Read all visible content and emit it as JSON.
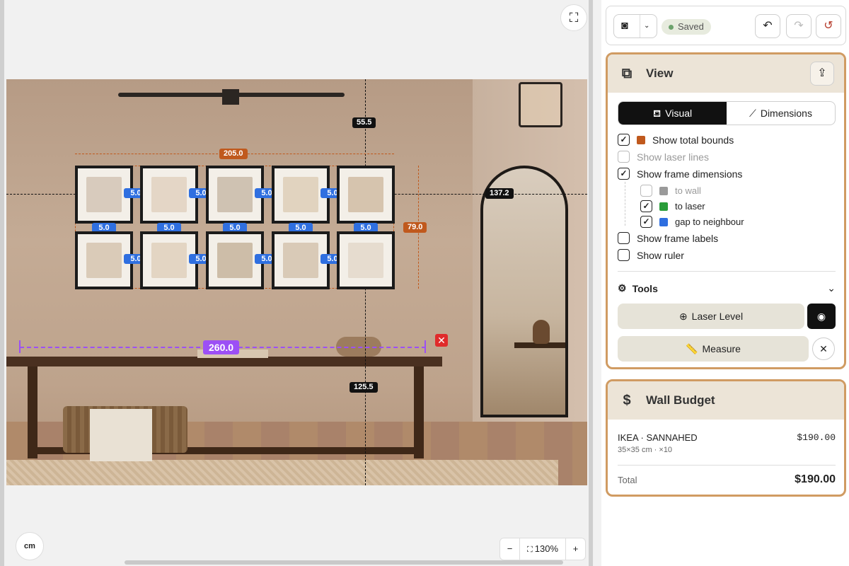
{
  "toolbar": {
    "saved_label": "Saved",
    "camera_icon": "camera-icon",
    "chevron_icon": "chevron-down-icon"
  },
  "canvas": {
    "labels": {
      "total_width": "205.0",
      "total_height": "79.0",
      "laser_top": "55.5",
      "laser_right": "137.2",
      "laser_bottom": "125.5",
      "measure": "260.0"
    },
    "gap_value": "5.0",
    "unit_label": "cm",
    "zoom": {
      "minus": "−",
      "value": "130%",
      "plus": "+"
    }
  },
  "view": {
    "title": "View",
    "tabs": [
      {
        "label": "Visual",
        "active": true
      },
      {
        "label": "Dimensions",
        "active": false
      }
    ],
    "options": [
      {
        "label": "Show total bounds",
        "checked": true,
        "swatch": "#c0591d"
      },
      {
        "label": "Show laser lines",
        "checked": false
      },
      {
        "label": "Show frame dimensions",
        "checked": true
      },
      {
        "label": "to wall",
        "checked": false,
        "swatch": "#9a9a9a"
      },
      {
        "label": "to laser",
        "checked": true,
        "swatch": "#2a9d3a"
      },
      {
        "label": "gap to neighbour",
        "checked": true,
        "swatch": "#2f6fe0"
      },
      {
        "label": "Show frame labels",
        "checked": false
      },
      {
        "label": "Show ruler",
        "checked": false
      }
    ],
    "tools_label": "Tools",
    "laser_label": "Laser Level",
    "measure_label": "Measure"
  },
  "budget": {
    "title": "Wall Budget",
    "item_name": "IKEA · SANNAHED",
    "item_price": "$190.00",
    "item_meta": "35×35 cm · ×10",
    "total_label": "Total",
    "total_value": "$190.00"
  }
}
